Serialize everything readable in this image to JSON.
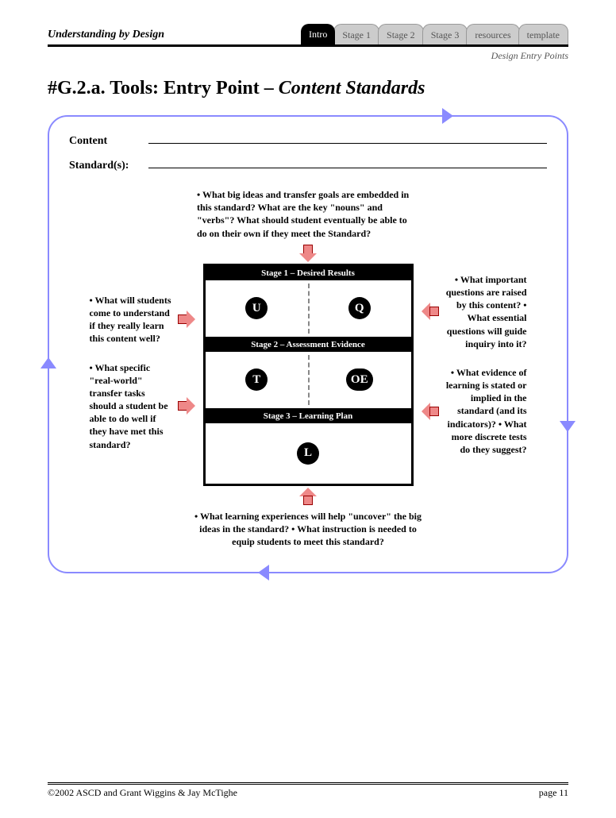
{
  "header": {
    "title": "Understanding by Design"
  },
  "tabs": [
    "Intro",
    "Stage 1",
    "Stage 2",
    "Stage 3",
    "resources",
    "template"
  ],
  "subhead": "Design Entry Points",
  "pageTitle": {
    "prefix": "#G.2.a. Tools: Entry Point – ",
    "italic": "Content Standards"
  },
  "fields": {
    "content": "Content",
    "standards": "Standard(s):"
  },
  "questions": {
    "top": "• What big ideas and transfer goals are embedded in this standard? What are the key \"nouns\" and \"verbs\"? What should student eventually be able to do on their own if they meet the Standard?",
    "leftU": "• What will students come to understand if they really learn this content well?",
    "leftT": "• What specific \"real-world\" transfer tasks should a student be able to do well if they have met this standard?",
    "rightQ": "• What important questions are raised by this content? • What essential questions will guide inquiry into it?",
    "rightOE": "• What evidence of learning is stated or implied in the standard (and its indicators)? • What more discrete tests do they suggest?",
    "bottom": "• What learning experiences will help \"uncover\" the big ideas in the standard? • What instruction is needed to equip students to meet this standard?"
  },
  "stages": {
    "s1": "Stage 1 – Desired Results",
    "s2": "Stage 2 – Assessment Evidence",
    "s3": "Stage 3 – Learning Plan"
  },
  "letters": {
    "u": "U",
    "q": "Q",
    "t": "T",
    "oe": "OE",
    "l": "L"
  },
  "footer": {
    "copy": "©2002 ASCD and Grant Wiggins & Jay McTighe",
    "page": "page 11"
  }
}
